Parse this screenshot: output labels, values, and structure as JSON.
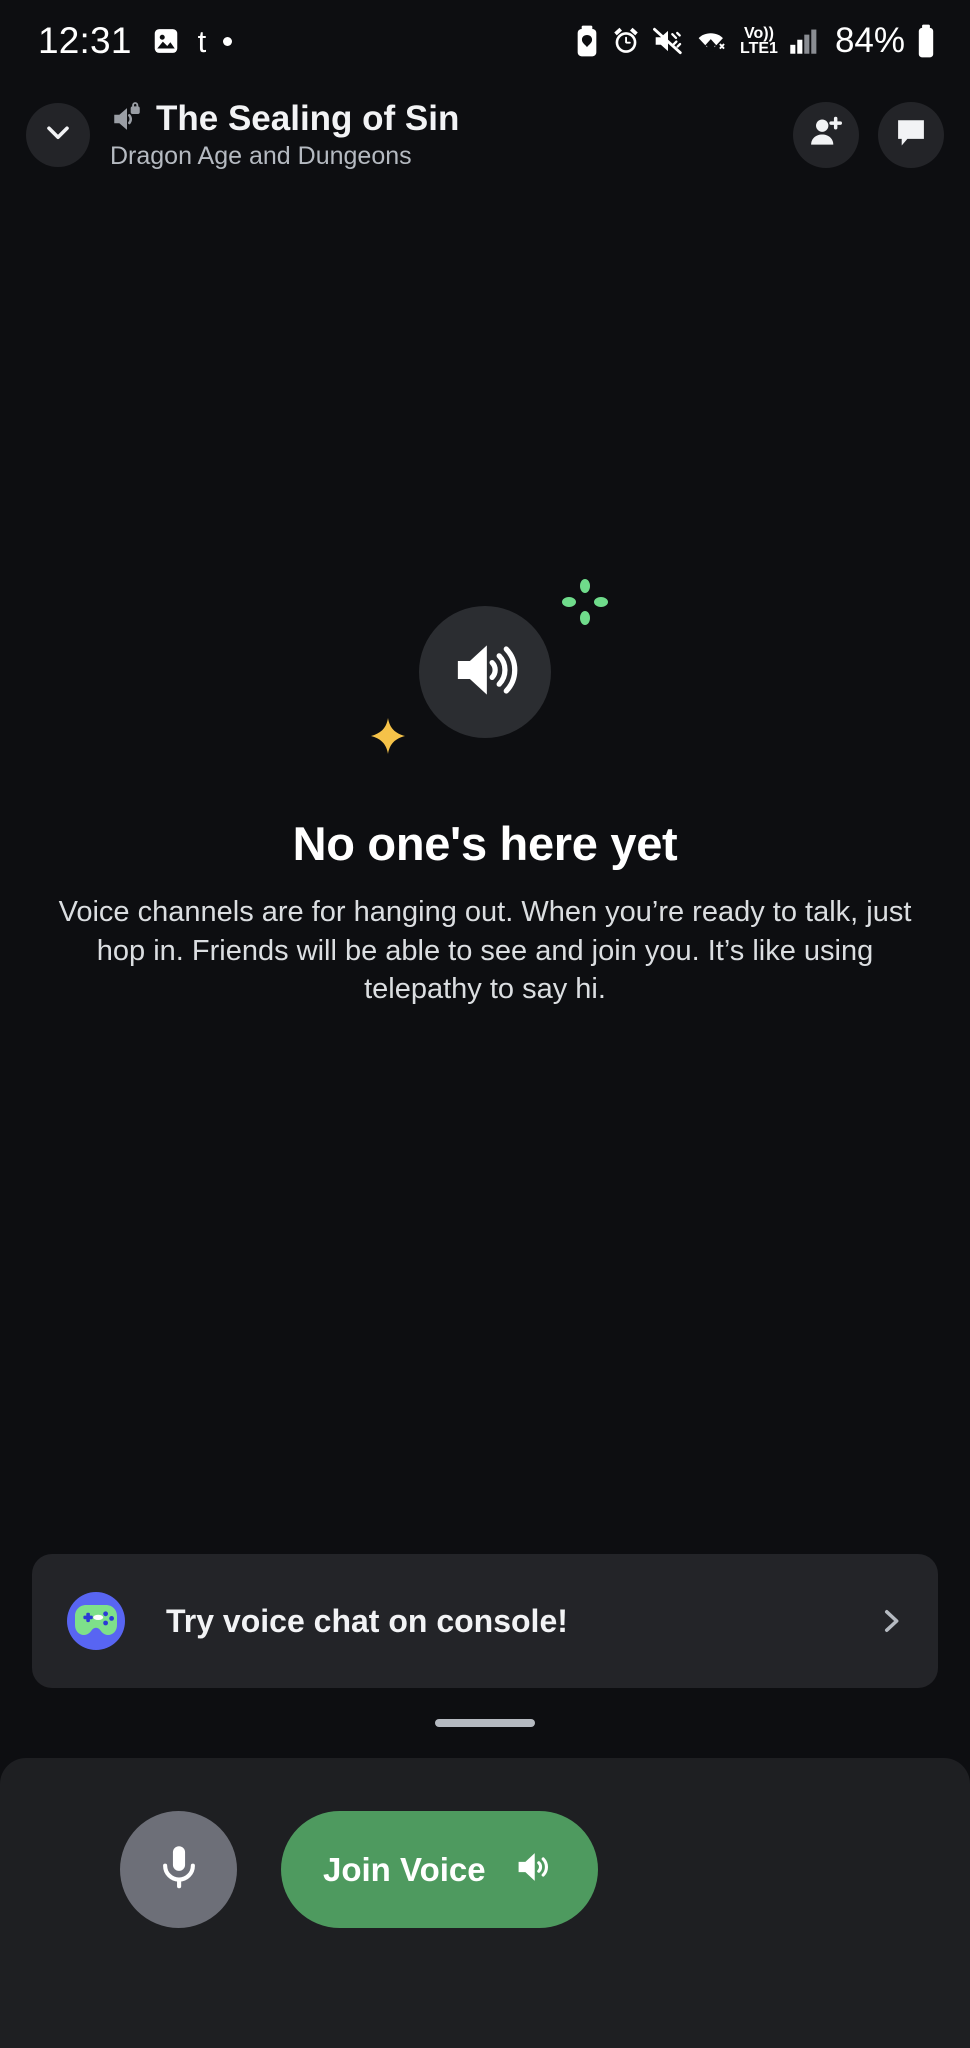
{
  "status_bar": {
    "time": "12:31",
    "battery_percent": "84%",
    "network_label_top": "Vo))",
    "network_label_bottom": "LTE1",
    "app_badge_letter": "t",
    "icons": [
      "image-icon",
      "tumblr-icon",
      "dot-icon",
      "battery-saver-icon",
      "alarm-icon",
      "vibrate-mute-icon",
      "wifi-icon",
      "volte-icon",
      "signal-bars-icon",
      "battery-icon"
    ]
  },
  "header": {
    "back_icon": "chevron-down-icon",
    "channel_icon": "voice-channel-locked-icon",
    "title": "The Sealing of Sin",
    "subtitle": "Dragon Age and Dungeons",
    "actions": [
      {
        "name": "invite-members-button",
        "icon": "person-add-icon"
      },
      {
        "name": "open-chat-button",
        "icon": "chat-bubble-icon"
      }
    ]
  },
  "empty_state": {
    "hero_icon": "speaker-icon",
    "sparkle_green": "sparkle-dots-icon",
    "sparkle_yellow": "four-point-star-icon",
    "title": "No one's here yet",
    "body": "Voice channels are for hanging out. When you’re ready to talk, just hop in. Friends will be able to see and join you. It’s like using telepathy to say hi."
  },
  "promo": {
    "icon": "console-gamepad-icon",
    "label": "Try voice chat on console!",
    "chevron": "chevron-right-icon"
  },
  "sheet": {
    "drag_handle": "drag-handle"
  },
  "bottom_bar": {
    "mic_button": {
      "name": "mute-toggle-button",
      "icon": "microphone-icon"
    },
    "join_button": {
      "label": "Join Voice",
      "icon": "speaker-icon"
    }
  },
  "colors": {
    "background": "#0d0e11",
    "surface": "#232428",
    "sheet": "#1e1f22",
    "accent_green": "#4e9a5f",
    "sparkle_green": "#6fdb8b",
    "sparkle_yellow": "#f5c249",
    "gamepad_green": "#7ee08a",
    "gamepad_blue": "#5865f2",
    "text_primary": "#f2f3f5",
    "text_muted": "#b5bac1",
    "mic_gray": "#6d6f78"
  }
}
